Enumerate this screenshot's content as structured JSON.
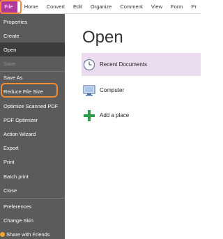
{
  "menubar": {
    "items": [
      "File",
      "Home",
      "Convert",
      "Edit",
      "Organize",
      "Comment",
      "View",
      "Form",
      "Pr"
    ]
  },
  "sidebar": {
    "items": [
      {
        "label": "Properties",
        "state": "normal"
      },
      {
        "label": "Create",
        "state": "normal"
      },
      {
        "label": "Open",
        "state": "active"
      },
      {
        "label": "Save",
        "state": "disabled"
      },
      {
        "label": "Save As",
        "state": "normal"
      },
      {
        "label": "Reduce File Size",
        "state": "highlighted"
      },
      {
        "label": "Optimize Scanned PDF",
        "state": "normal"
      },
      {
        "label": "PDF Optimizer",
        "state": "normal"
      },
      {
        "label": "Action Wizard",
        "state": "normal"
      },
      {
        "label": "Export",
        "state": "normal"
      },
      {
        "label": "Print",
        "state": "normal"
      },
      {
        "label": "Batch print",
        "state": "normal"
      },
      {
        "label": "Close",
        "state": "normal"
      },
      {
        "label": "Preferences",
        "state": "normal"
      },
      {
        "label": "Change Skin",
        "state": "normal"
      },
      {
        "label": "Share with Friends",
        "state": "normal"
      }
    ]
  },
  "main": {
    "title": "Open",
    "locations": [
      {
        "label": "Recent Documents",
        "icon": "clock-icon",
        "selected": true
      },
      {
        "label": "Computer",
        "icon": "computer-icon",
        "selected": false
      },
      {
        "label": "Add a place",
        "icon": "plus-icon",
        "selected": false
      }
    ]
  },
  "colors": {
    "file_tab": "#b03a9c",
    "highlight_outline": "#f18b36",
    "sidebar_bg": "#5b5b5b",
    "sidebar_active": "#3c3c3c",
    "selected_location": "#ecdcf0",
    "plus_green": "#2e9e4a"
  }
}
